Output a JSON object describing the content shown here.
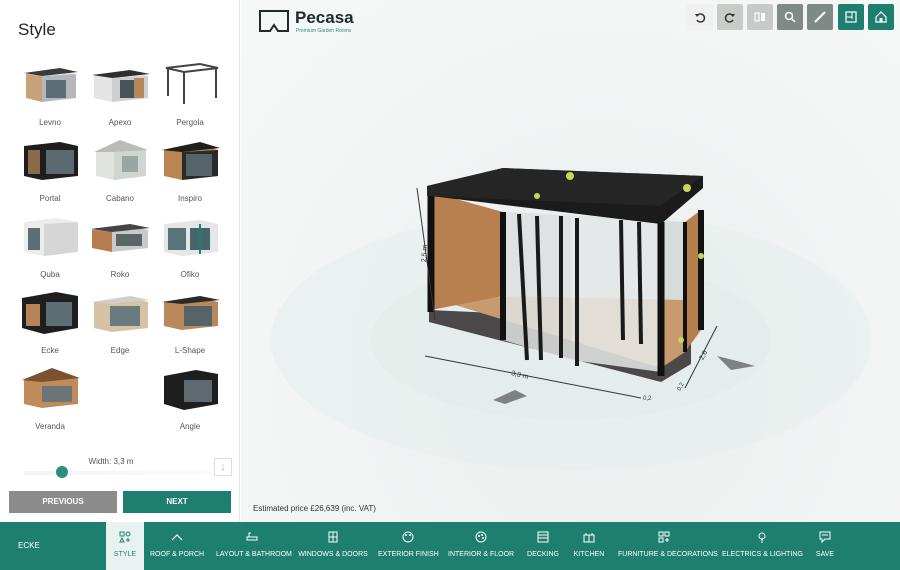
{
  "sidebar": {
    "title": "Style",
    "styles": [
      {
        "label": "Levno"
      },
      {
        "label": "Apexo"
      },
      {
        "label": "Pergola"
      },
      {
        "label": "Portal"
      },
      {
        "label": "Cabano"
      },
      {
        "label": "Inspiro"
      },
      {
        "label": "Quba"
      },
      {
        "label": "Roko"
      },
      {
        "label": "Ofiko"
      },
      {
        "label": "Ecke"
      },
      {
        "label": "Edge"
      },
      {
        "label": "L-Shape"
      },
      {
        "label": "Veranda"
      },
      {
        "label": "Angle"
      }
    ],
    "width_label": "Width: 3,3 m",
    "width_fraction": 0.2,
    "prev_label": "PREVIOUS",
    "next_label": "NEXT"
  },
  "viewport": {
    "logo_text": "Pecasa",
    "logo_sub": "Premium Garden Rooms",
    "price": "Estimated price £26,639 (inc. VAT)",
    "dimensions": {
      "height": "2,5 m",
      "width": "3,3 m",
      "depth": "2,6",
      "corner_a": "0,2",
      "corner_b": "0,2"
    },
    "toolbar": [
      "undo-icon",
      "redo-icon",
      "mirror-icon",
      "zoom-icon",
      "measure-icon",
      "floorplan-icon",
      "home-icon"
    ]
  },
  "bottom_nav": {
    "current": "ECKE",
    "items": [
      {
        "label": "STYLE"
      },
      {
        "label": "ROOF & PORCH"
      },
      {
        "label": "LAYOUT & BATHROOM"
      },
      {
        "label": "WINDOWS & DOORS"
      },
      {
        "label": "EXTERIOR FINISH"
      },
      {
        "label": "INTERIOR & FLOOR"
      },
      {
        "label": "DECKING"
      },
      {
        "label": "KITCHEN"
      },
      {
        "label": "FURNITURE & DECORATIONS"
      },
      {
        "label": "ELECTRICS & LIGHTING"
      },
      {
        "label": "SAVE"
      }
    ]
  },
  "colors": {
    "accent": "#1e7f6f",
    "prev_button": "#8b8b8b"
  }
}
